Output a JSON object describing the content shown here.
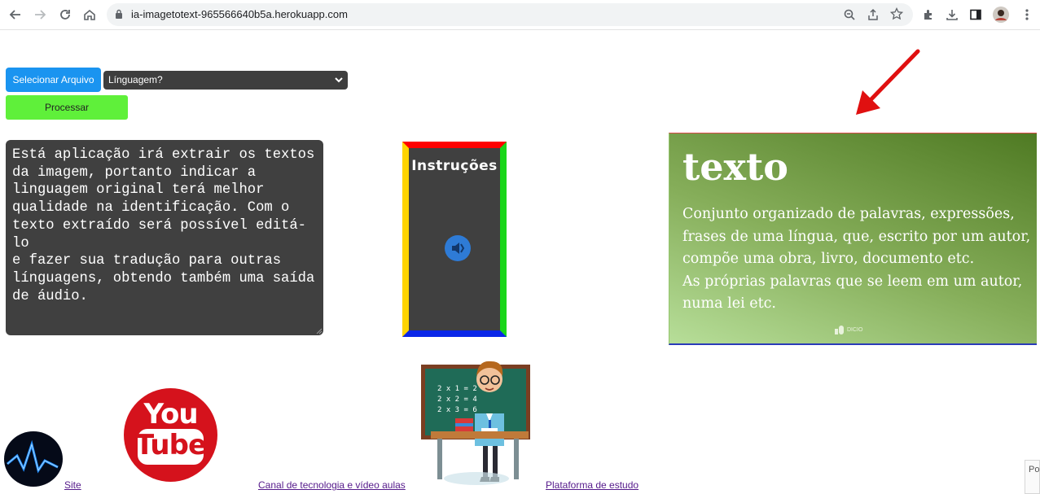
{
  "browser": {
    "url": "ia-imagetotext-965566640b5a.herokuapp.com"
  },
  "toolbar": {
    "select_file_label": "Selecionar Arquivo",
    "language_value": "Línguagem?",
    "process_label": "Processar"
  },
  "description_text": "Está aplicação irá extrair os textos\nda imagem, portanto indicar a\nlinguagem original terá melhor\nqualidade na identificação. Com o\ntexto extraído será possível editá-lo\ne fazer sua tradução para outras\nlínguagens, obtendo também uma saída\nde áudio.",
  "instructions": {
    "title": "Instruções",
    "icon": "audio-player-icon"
  },
  "word_card": {
    "title": "texto",
    "definition": "Conjunto organizado de palavras, expressões, frases de uma língua, que, escrito por um autor, compõe uma obra, livro, documento etc.\nAs próprias palavras que se leem em um autor, numa lei etc.",
    "logo_text": "DICIO"
  },
  "footer": {
    "site_label": "Site",
    "channel_label": "Canal de tecnologia e vídeo aulas",
    "platform_label": "Plataforma de estudo",
    "youtube_logo_text_1": "You",
    "youtube_logo_text_2": "Tube",
    "blackboard_lines": [
      "2 x 1 = 2",
      "2 x 2 = 4",
      "2 x 3 = 6"
    ]
  },
  "side_popup_text": "Po",
  "colors": {
    "select_button": "#1a94f0",
    "process_button": "#5ff03a",
    "panel_dark": "#404040",
    "arrow": "#e01010",
    "link": "#551a8b"
  }
}
